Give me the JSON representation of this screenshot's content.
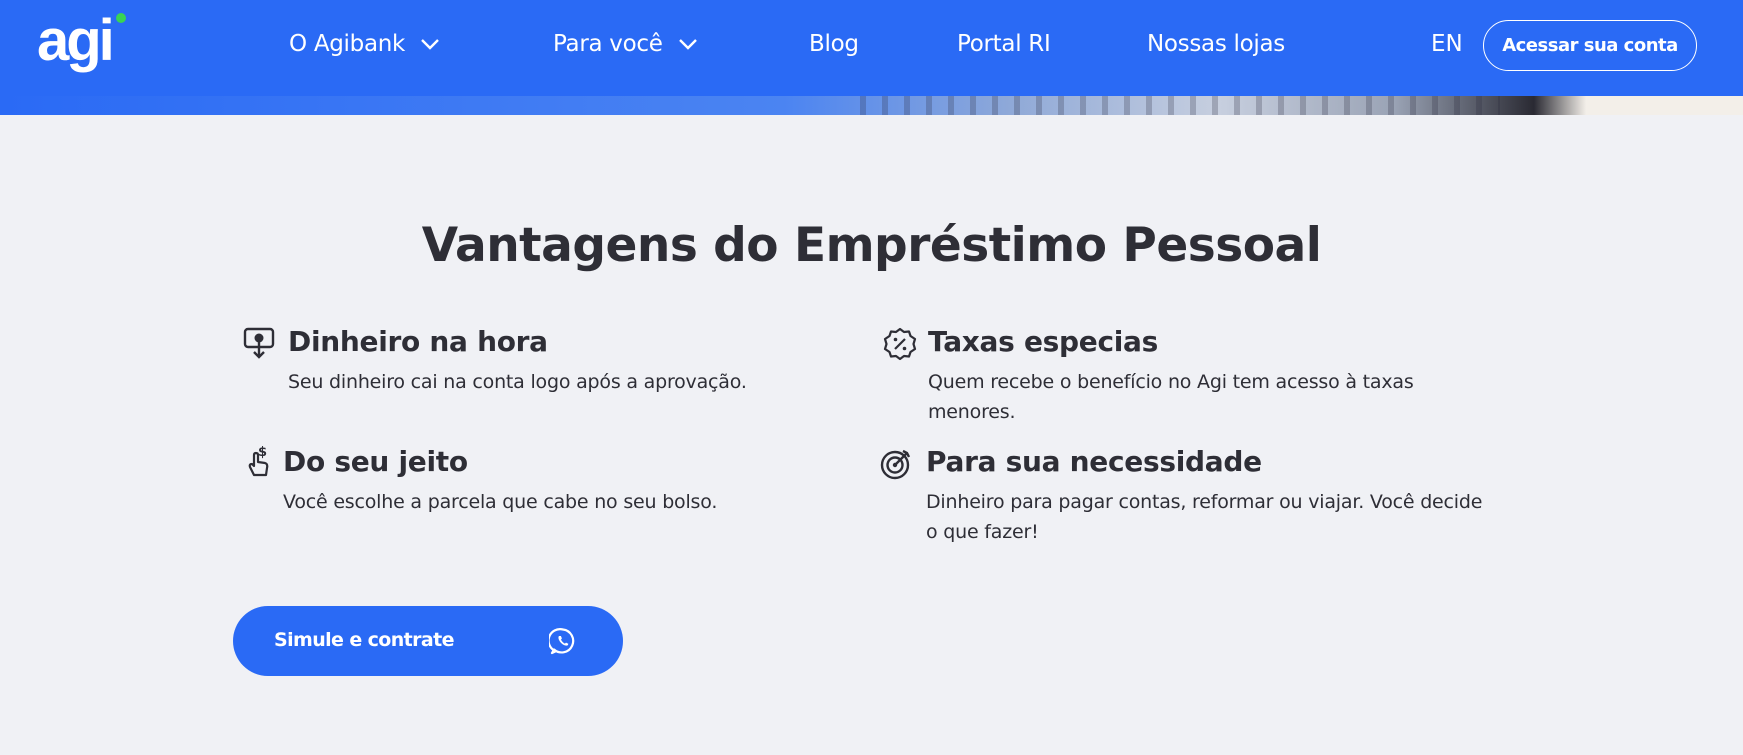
{
  "header": {
    "logo_text": "agi",
    "nav": [
      {
        "label": "O Agibank",
        "has_dropdown": true
      },
      {
        "label": "Para você",
        "has_dropdown": true
      },
      {
        "label": "Blog"
      },
      {
        "label": "Portal RI"
      },
      {
        "label": "Nossas lojas"
      }
    ],
    "language": "EN",
    "login_label": "Acessar sua conta"
  },
  "section": {
    "title": "Vantagens do Empréstimo Pessoal",
    "features": [
      {
        "icon": "money-hand-icon",
        "title": "Dinheiro na hora",
        "description": "Seu dinheiro cai na conta logo após a aprovação."
      },
      {
        "icon": "percent-badge-icon",
        "title": "Taxas especias",
        "description": "Quem recebe o benefício no Agi tem acesso à taxas menores."
      },
      {
        "icon": "hand-dollar-icon",
        "title": "Do seu jeito",
        "description": "Você escolhe a parcela que cabe no seu bolso."
      },
      {
        "icon": "target-icon",
        "title": "Para sua necessidade",
        "description": "Dinheiro para pagar contas, reformar ou viajar. Você decide o que fazer!"
      }
    ]
  },
  "cta": {
    "label": "Simule e contrate",
    "icon": "whatsapp-icon"
  },
  "colors": {
    "brand_blue": "#2a6af5",
    "logo_dot_green": "#39d353",
    "background": "#f0f1f5",
    "text": "#2e2e36"
  }
}
